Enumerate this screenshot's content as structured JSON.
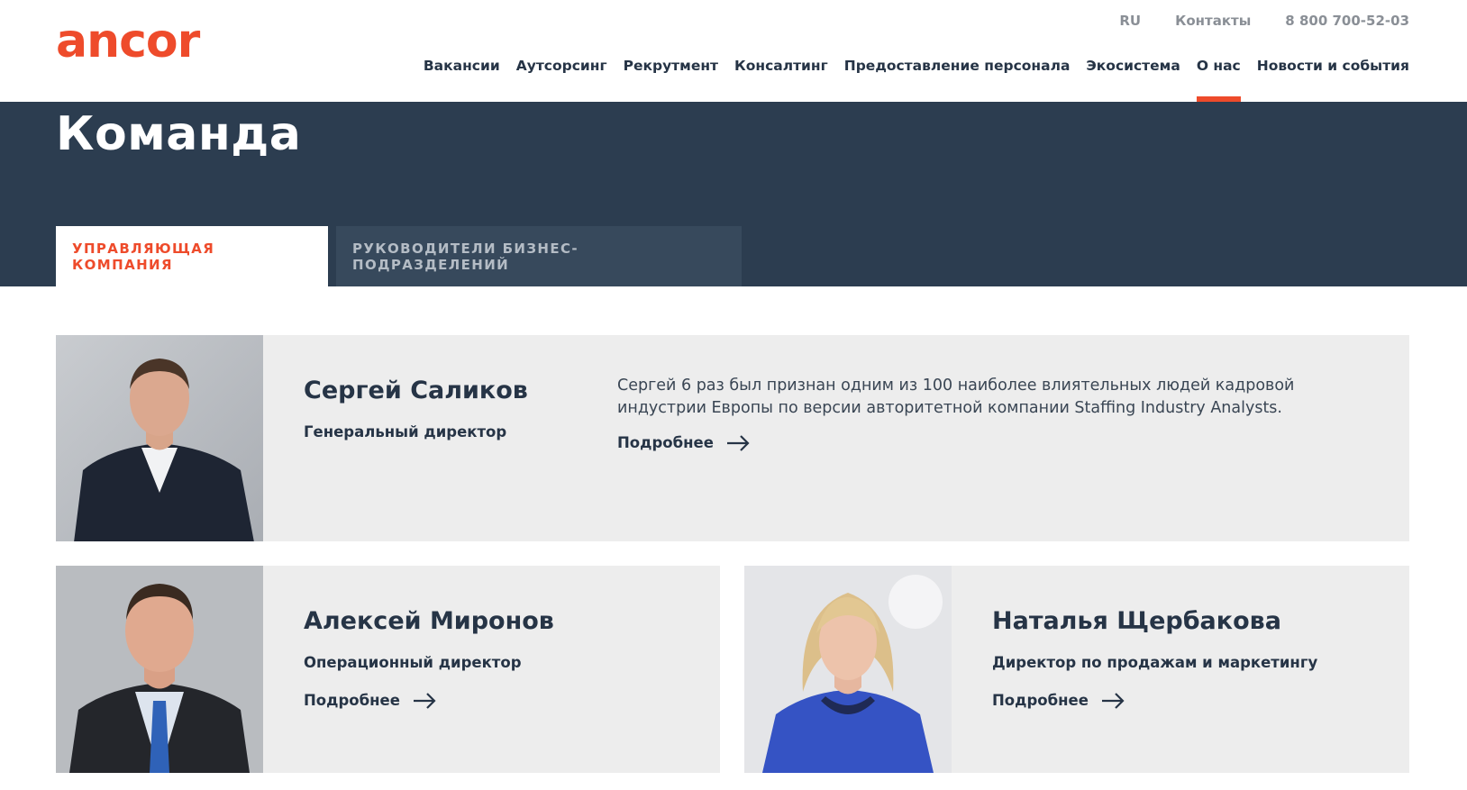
{
  "header": {
    "logo_text": "ancor",
    "lang": "RU",
    "contacts": "Контакты",
    "phone": "8 800 700-52-03",
    "nav": [
      {
        "label": "Вакансии"
      },
      {
        "label": "Аутсорсинг"
      },
      {
        "label": "Рекрутмент"
      },
      {
        "label": "Консалтинг"
      },
      {
        "label": "Предоставление персонала"
      },
      {
        "label": "Экосистема"
      },
      {
        "label": "О нас",
        "active": true
      },
      {
        "label": "Новости и события"
      }
    ]
  },
  "hero": {
    "title": "Команда",
    "tabs": [
      {
        "label": "УПРАВЛЯЮЩАЯ КОМПАНИЯ",
        "active": true
      },
      {
        "label": "РУКОВОДИТЕЛИ БИЗНЕС-ПОДРАЗДЕЛЕНИЙ",
        "active": false
      }
    ]
  },
  "team": [
    {
      "name": "Сергей Саликов",
      "role": "Генеральный директор",
      "description": "Сергей 6 раз был признан одним из 100 наиболее влиятельных людей кадровой индустрии Европы по версии авторитетной компании Staffing Industry Analysts.",
      "more": "Подробнее"
    },
    {
      "name": "Алексей Миронов",
      "role": "Операционный директор",
      "more": "Подробнее"
    },
    {
      "name": "Наталья Щербакова",
      "role": "Директор по продажам и маркетингу",
      "more": "Подробнее"
    }
  ],
  "colors": {
    "accent": "#ee4b2b",
    "hero_bg": "#2c3d50",
    "card_bg": "#ededed",
    "text_dark": "#263446"
  }
}
